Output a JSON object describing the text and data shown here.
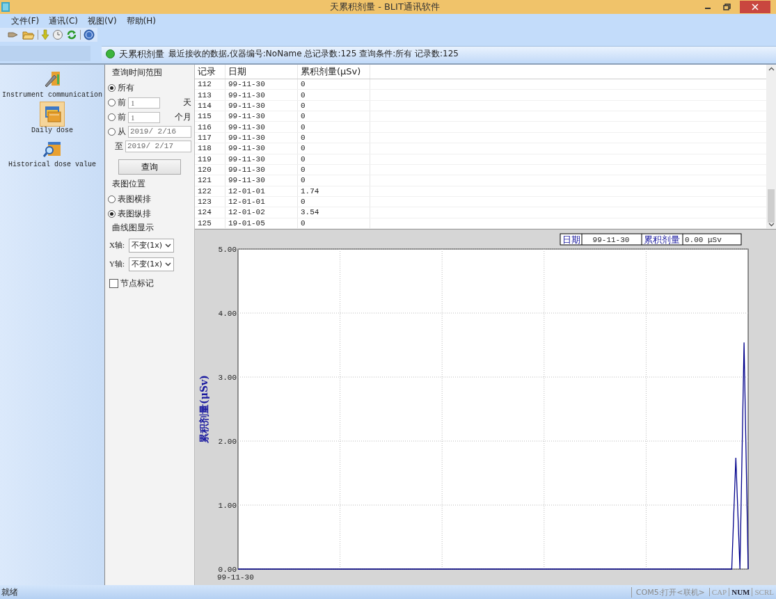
{
  "window": {
    "title": "天累积剂量 - BLIT通讯软件"
  },
  "menu": [
    "文件(F)",
    "通讯(C)",
    "视图(V)",
    "帮助(H)"
  ],
  "info_bar": {
    "title": "天累积剂量",
    "message": "最近接收的数据,仪器编号:NoName 总记录数:125 查询条件:所有 记录数:125"
  },
  "sidebar": {
    "items": [
      {
        "label": "Instrument communication",
        "selected": false
      },
      {
        "label": "Daily dose",
        "selected": true
      },
      {
        "label": "Historical dose value",
        "selected": false
      }
    ]
  },
  "query": {
    "time_range": {
      "title": "查询时间范围",
      "options": [
        {
          "kind": "plain",
          "label": "所有",
          "selected": true
        },
        {
          "kind": "spin",
          "label": "前",
          "value": "1",
          "unit": "天",
          "selected": false
        },
        {
          "kind": "spin",
          "label": "前",
          "value": "1",
          "unit": "个月",
          "selected": false
        },
        {
          "kind": "date",
          "label": "从",
          "value": "2019/ 2/16",
          "selected": false
        }
      ],
      "to": {
        "label": "至",
        "value": "2019/ 2/17"
      },
      "button": "查询"
    },
    "layout": {
      "title": "表图位置",
      "options": [
        {
          "label": "表图横排",
          "selected": false
        },
        {
          "label": "表图纵排",
          "selected": true
        }
      ]
    },
    "curve": {
      "title": "曲线图显示",
      "axes": [
        {
          "label": "X轴:",
          "value": "不变(1x)"
        },
        {
          "label": "Y轴:",
          "value": "不变(1x)"
        }
      ],
      "node_marks": {
        "label": "节点标记",
        "checked": false
      }
    }
  },
  "table": {
    "columns": [
      "记录",
      "日期",
      "累积剂量(μSv)"
    ],
    "rows": [
      [
        "112",
        "99-11-30",
        "0"
      ],
      [
        "113",
        "99-11-30",
        "0"
      ],
      [
        "114",
        "99-11-30",
        "0"
      ],
      [
        "115",
        "99-11-30",
        "0"
      ],
      [
        "116",
        "99-11-30",
        "0"
      ],
      [
        "117",
        "99-11-30",
        "0"
      ],
      [
        "118",
        "99-11-30",
        "0"
      ],
      [
        "119",
        "99-11-30",
        "0"
      ],
      [
        "120",
        "99-11-30",
        "0"
      ],
      [
        "121",
        "99-11-30",
        "0"
      ],
      [
        "122",
        "12-01-01",
        "1.74"
      ],
      [
        "123",
        "12-01-01",
        "0"
      ],
      [
        "124",
        "12-01-02",
        "3.54"
      ],
      [
        "125",
        "19-01-05",
        "0"
      ]
    ]
  },
  "chart": {
    "start_label": "99-11-30",
    "legend": {
      "date_label": "日期",
      "date": "99-11-30",
      "dose_label": "累积剂量",
      "dose": "0.00 μSv"
    },
    "chart_data": {
      "type": "line",
      "ylabel": "累积剂量(μSv)",
      "ylim": [
        0,
        5
      ],
      "yticks": [
        {
          "value": 0,
          "label": "0.00"
        },
        {
          "value": 1,
          "label": "1.00"
        },
        {
          "value": 2,
          "label": "2.00"
        },
        {
          "value": 3,
          "label": "3.00"
        },
        {
          "value": 4,
          "label": "4.00"
        },
        {
          "value": 5,
          "label": "5.00"
        }
      ],
      "grid": true,
      "series": [
        {
          "color": "#00008b",
          "values": [
            0,
            0,
            0,
            0,
            0,
            0,
            0,
            0,
            0,
            0,
            0,
            0,
            0,
            0,
            0,
            0,
            0,
            0,
            0,
            0,
            0,
            0,
            0,
            0,
            0,
            0,
            0,
            0,
            0,
            0,
            0,
            0,
            0,
            0,
            0,
            0,
            0,
            0,
            0,
            0,
            0,
            0,
            0,
            0,
            0,
            0,
            0,
            0,
            0,
            0,
            0,
            0,
            0,
            0,
            0,
            0,
            0,
            0,
            0,
            0,
            0,
            0,
            0,
            0,
            0,
            0,
            0,
            0,
            0,
            0,
            0,
            0,
            0,
            0,
            0,
            0,
            0,
            0,
            0,
            0,
            0,
            0,
            0,
            0,
            0,
            0,
            0,
            0,
            0,
            0,
            0,
            0,
            0,
            0,
            0,
            0,
            0,
            0,
            0,
            0,
            0,
            0,
            0,
            0,
            0,
            0,
            0,
            0,
            0,
            0,
            0,
            0,
            0,
            0,
            0,
            0,
            0,
            0,
            0,
            0,
            0,
            1.74,
            0,
            3.54,
            0
          ]
        }
      ]
    }
  },
  "status_bar": {
    "text": "就绪",
    "port": "COM5:打开<联机>",
    "indicators": [
      {
        "label": "CAP",
        "on": false
      },
      {
        "label": "NUM",
        "on": true
      },
      {
        "label": "SCRL",
        "on": false
      }
    ]
  }
}
